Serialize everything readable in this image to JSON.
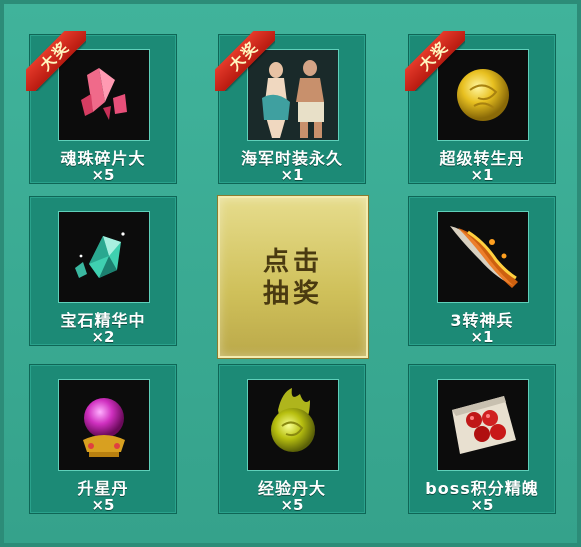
{
  "draw_button": {
    "line1": "点击",
    "line2": "抽奖"
  },
  "grand_prize_label": "大奖",
  "prizes": [
    {
      "name": "魂珠碎片大",
      "qty": "×5",
      "icon": "pink-crystal-shard-icon",
      "grand": true
    },
    {
      "name": "海军时装永久",
      "qty": "×1",
      "icon": "navy-costume-icon",
      "grand": true
    },
    {
      "name": "超级转生丹",
      "qty": "×1",
      "icon": "golden-rebirth-pill-icon",
      "grand": true
    },
    {
      "name": "宝石精华中",
      "qty": "×2",
      "icon": "teal-gem-icon",
      "grand": false
    },
    {
      "name": "3转神兵",
      "qty": "×1",
      "icon": "flaming-blade-icon",
      "grand": false
    },
    {
      "name": "升星丹",
      "qty": "×5",
      "icon": "purple-orb-icon",
      "grand": false
    },
    {
      "name": "经验丹大",
      "qty": "×5",
      "icon": "green-flame-orb-icon",
      "grand": false
    },
    {
      "name": "boss积分精魄",
      "qty": "×5",
      "icon": "red-beads-scroll-icon",
      "grand": false
    }
  ]
}
